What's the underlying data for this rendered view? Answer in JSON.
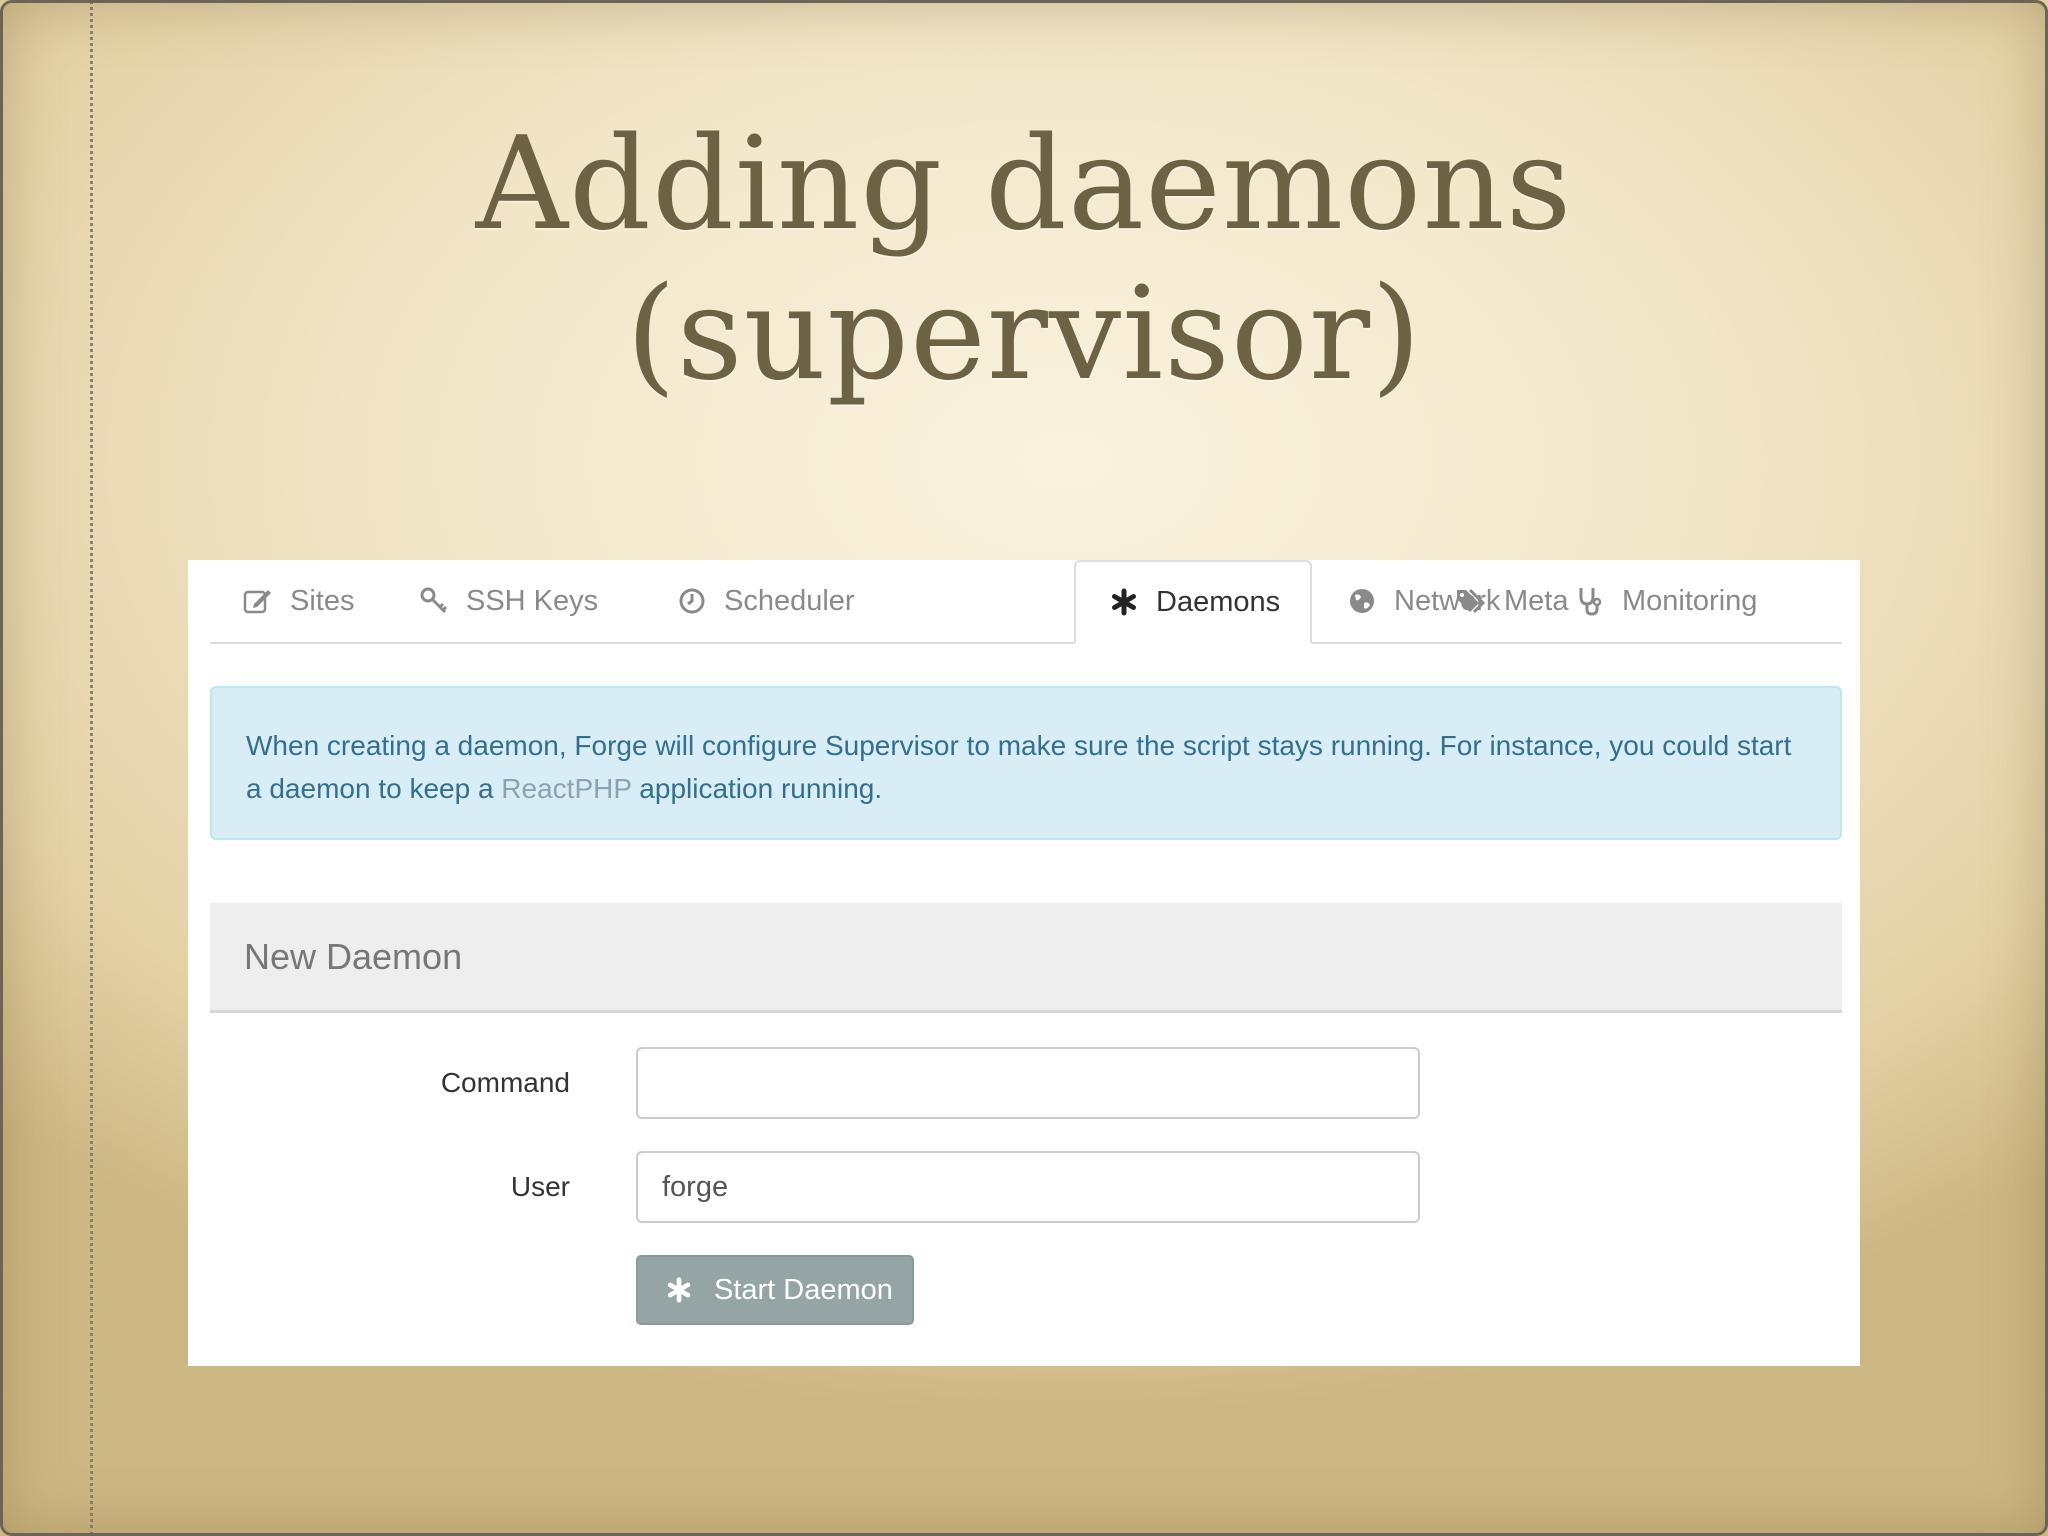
{
  "slide": {
    "title_line1": "Adding daemons",
    "title_line2": "(supervisor)"
  },
  "tabs": [
    {
      "label": "Sites",
      "icon": "edit-icon",
      "active": false
    },
    {
      "label": "SSH Keys",
      "icon": "key-icon",
      "active": false
    },
    {
      "label": "Scheduler",
      "icon": "clock-icon",
      "active": false
    },
    {
      "label": "Daemons",
      "icon": "asterisk-icon",
      "active": true
    },
    {
      "label": "Network",
      "icon": "globe-icon",
      "active": false
    },
    {
      "label": "Monitoring",
      "icon": "stethoscope-icon",
      "active": false
    },
    {
      "label": "Meta",
      "icon": "tags-icon",
      "active": false
    }
  ],
  "alert": {
    "text_before_link": "When creating a daemon, Forge will configure Supervisor to make sure the script stays running. For instance, you could start a daemon to keep a ",
    "link_text": "ReactPHP",
    "text_after_link": " application running."
  },
  "new_daemon": {
    "heading": "New Daemon",
    "command_label": "Command",
    "command_value": "",
    "user_label": "User",
    "user_value": "forge",
    "start_button_label": "Start Daemon"
  },
  "colors": {
    "title": "#6e6245",
    "alert_bg": "#d9edf7",
    "alert_text": "#31708f",
    "button_bg": "#95a5a6"
  }
}
